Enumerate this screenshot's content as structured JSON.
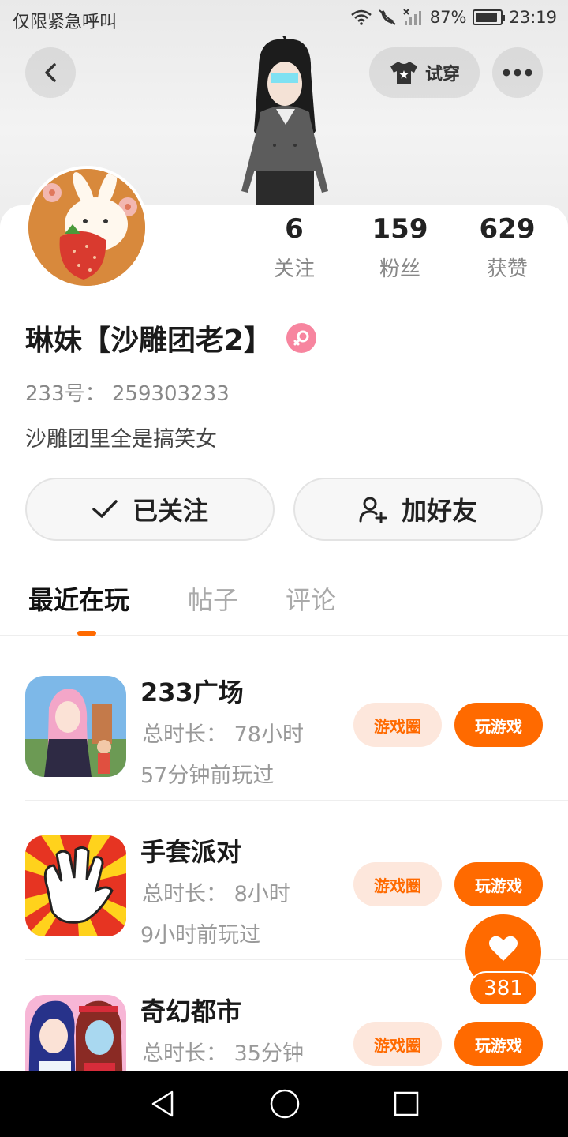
{
  "status_bar": {
    "carrier_text": "仅限紧急呼叫",
    "battery": "87%",
    "battery_level": 0.87,
    "time": "23:19"
  },
  "header": {
    "try_on_label": "试穿"
  },
  "profile": {
    "stats": [
      {
        "value": "6",
        "label": "关注"
      },
      {
        "value": "159",
        "label": "粉丝"
      },
      {
        "value": "629",
        "label": "获赞"
      }
    ],
    "name": "琳妹【沙雕团老2】",
    "gender_symbol": "♀",
    "uid_text": "233号： 259303233",
    "bio": "沙雕团里全是搞笑女",
    "follow_button": "已关注",
    "add_friend_button": "加好友"
  },
  "tabs": [
    {
      "label": "最近在玩",
      "active": true
    },
    {
      "label": "帖子",
      "active": false
    },
    {
      "label": "评论",
      "active": false
    }
  ],
  "games": [
    {
      "title": "233广场",
      "duration": "总时长： 78小时",
      "last_played": "57分钟前玩过",
      "circle_label": "游戏圈",
      "play_label": "玩游戏"
    },
    {
      "title": "手套派对",
      "duration": "总时长： 8小时",
      "last_played": "9小时前玩过",
      "circle_label": "游戏圈",
      "play_label": "玩游戏"
    },
    {
      "title": "奇幻都市",
      "duration": "总时长： 35分钟",
      "last_played": "",
      "circle_label": "游戏圈",
      "play_label": "玩游戏"
    }
  ],
  "like_fab": {
    "count": "381"
  },
  "colors": {
    "accent": "#ff6a00",
    "accent_soft": "#fde7dc",
    "gender_pink": "#f7859f"
  }
}
